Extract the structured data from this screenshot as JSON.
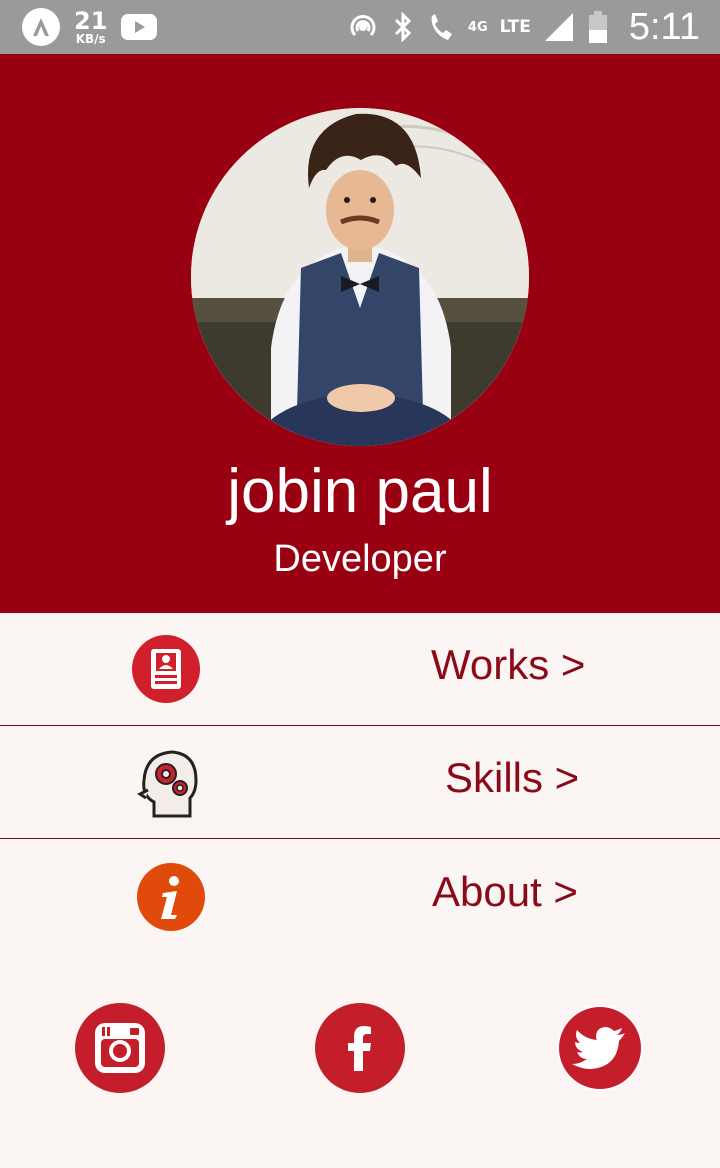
{
  "status_bar": {
    "speed_value": "21",
    "speed_unit": "KB/s",
    "network_4g": "4G",
    "network_lte": "LTE",
    "time": "5:11"
  },
  "profile": {
    "name": "jobin paul",
    "role": "Developer"
  },
  "menu": [
    {
      "label": "Works >",
      "icon": "resume-icon"
    },
    {
      "label": "Skills >",
      "icon": "head-gears-icon"
    },
    {
      "label": "About >",
      "icon": "info-icon"
    }
  ],
  "social": [
    {
      "icon": "instagram-icon"
    },
    {
      "icon": "facebook-icon"
    },
    {
      "icon": "twitter-icon"
    }
  ],
  "colors": {
    "header_bg": "#990012",
    "accent": "#8a0a1a",
    "icon_red": "#d0202c",
    "info_orange": "#e04a0a",
    "page_bg": "#fbf6f4"
  }
}
